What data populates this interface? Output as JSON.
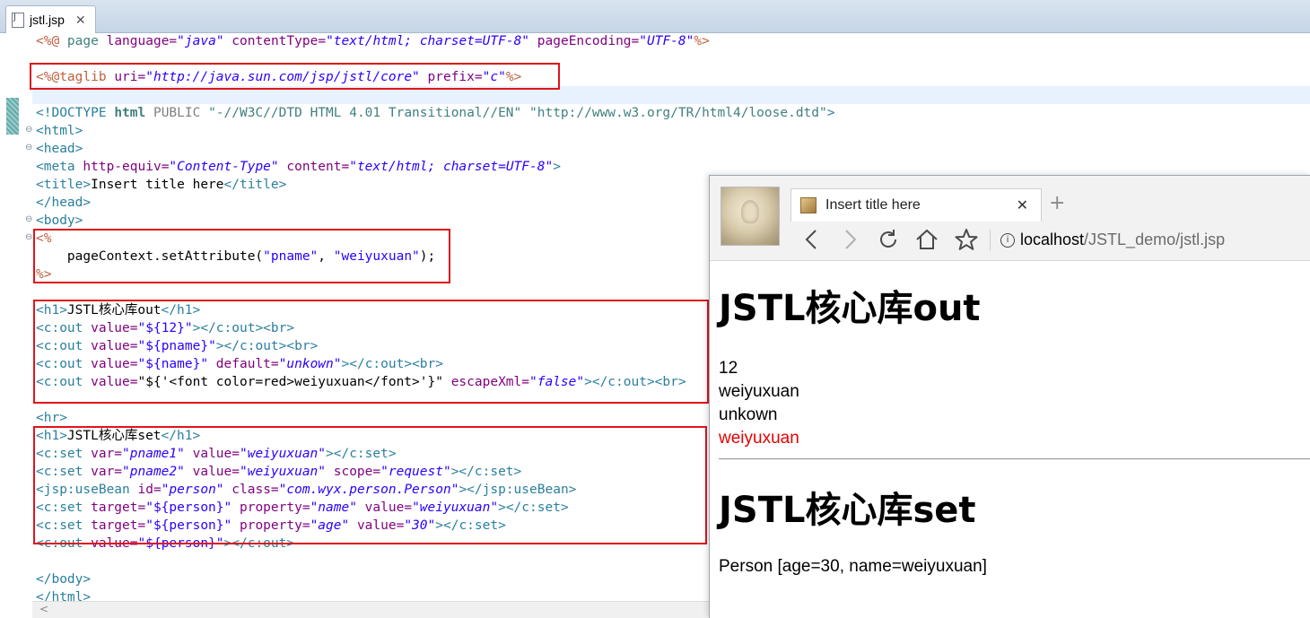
{
  "editor": {
    "tab_label": "jstl.jsp",
    "tab_close": "✕"
  },
  "code": {
    "l1": {
      "a": "<%@",
      "b": " page ",
      "c": "language=",
      "d": "\"java\"",
      "e": " contentType=",
      "f": "\"text/html; charset=UTF-8\"",
      "g": " pageEncoding=",
      "h": "\"UTF-8\"",
      "i": "%>"
    },
    "l3": {
      "a": "<%@taglib ",
      "b": "uri=",
      "c": "\"http://java.sun.com/jsp/jstl/core\"",
      "d": " prefix=",
      "e": "\"c\"",
      "f": "%>"
    },
    "l5": {
      "a": "<!DOCTYPE ",
      "b": "html",
      "c": " PUBLIC ",
      "d": "\"-//W3C//DTD HTML 4.01 Transitional//EN\"",
      "e": " \"http://www.w3.org/TR/html4/loose.dtd\"",
      "f": ">"
    },
    "l6": "<html>",
    "l7": "<head>",
    "l8": {
      "a": "<meta ",
      "b": "http-equiv=",
      "c": "\"Content-Type\"",
      "d": " content=",
      "e": "\"text/html; charset=UTF-8\"",
      "f": ">"
    },
    "l9": {
      "a": "<title>",
      "b": "Insert title here",
      "c": "</title>"
    },
    "l10": "</head>",
    "l11": "<body>",
    "l12": "<%",
    "l13": {
      "a": "    pageContext.setAttribute(",
      "b": "\"pname\"",
      "c": ", ",
      "d": "\"weiyuxuan\"",
      "e": ");"
    },
    "l14": "%>",
    "l16": {
      "a": "<h1>",
      "b": "JSTL核心库out",
      "c": "</h1>"
    },
    "l17": {
      "a": "<c:out ",
      "b": "value=",
      "c": "\"${12}\"",
      "d": "></c:out><br>"
    },
    "l18": {
      "a": "<c:out ",
      "b": "value=",
      "c": "\"${pname}\"",
      "d": "></c:out><br>"
    },
    "l19": {
      "a": "<c:out ",
      "b": "value=",
      "c": "\"${name}\"",
      "d": " default=",
      "e": "\"unkown\"",
      "f": "></c:out><br>"
    },
    "l20": {
      "a": "<c:out ",
      "b": "value=",
      "c": "\"${'<font color=red>weiyuxuan</font>'}\"",
      "d": " escapeXml=",
      "e": "\"false\"",
      "f": "></c:out><br>"
    },
    "l22": "<hr>",
    "l23": {
      "a": "<h1>",
      "b": "JSTL核心库set",
      "c": "</h1>"
    },
    "l24": {
      "a": "<c:set ",
      "b": "var=",
      "c": "\"pname1\"",
      "d": " value=",
      "e": "\"weiyuxuan\"",
      "f": "></c:set>"
    },
    "l25": {
      "a": "<c:set ",
      "b": "var=",
      "c": "\"pname2\"",
      "d": " value=",
      "e": "\"weiyuxuan\"",
      "f": " scope=",
      "g": "\"request\"",
      "h": "></c:set>"
    },
    "l26": {
      "a": "<jsp:useBean ",
      "b": "id=",
      "c": "\"person\"",
      "d": " class=",
      "e": "\"com.wyx.person.Person\"",
      "f": "></jsp:useBean>"
    },
    "l27": {
      "a": "<c:set ",
      "b": "target=",
      "c": "\"${person}\"",
      "d": " property=",
      "e": "\"name\"",
      "f": " value=",
      "g": "\"weiyuxuan\"",
      "h": "></c:set>"
    },
    "l28": {
      "a": "<c:set ",
      "b": "target=",
      "c": "\"${person}\"",
      "d": " property=",
      "e": "\"age\"",
      "f": " value=",
      "g": "\"30\"",
      "h": "></c:set>"
    },
    "l29": {
      "a": "<c:out ",
      "b": "value=",
      "c": "\"${person}\"",
      "d": "></c:out>"
    },
    "l31": "</body>",
    "l32": "</html>"
  },
  "browser": {
    "tab_title": "Insert title here",
    "tab_close": "✕",
    "new_tab": "+",
    "url_host": "localhost",
    "url_path": "/JSTL_demo/jstl.jsp",
    "icons": [
      "back-icon",
      "forward-icon",
      "reload-icon",
      "home-icon",
      "star-icon",
      "info-icon"
    ],
    "page": {
      "h1_out": "JSTL核心库out",
      "out1": "12",
      "out2": "weiyuxuan",
      "out3": "unkown",
      "out4": "weiyuxuan",
      "h1_set": "JSTL核心库set",
      "person": "Person [age=30, name=weiyuxuan]"
    },
    "colors": {
      "red_text": "#e60000",
      "highlight_box": "#e0141a"
    }
  }
}
